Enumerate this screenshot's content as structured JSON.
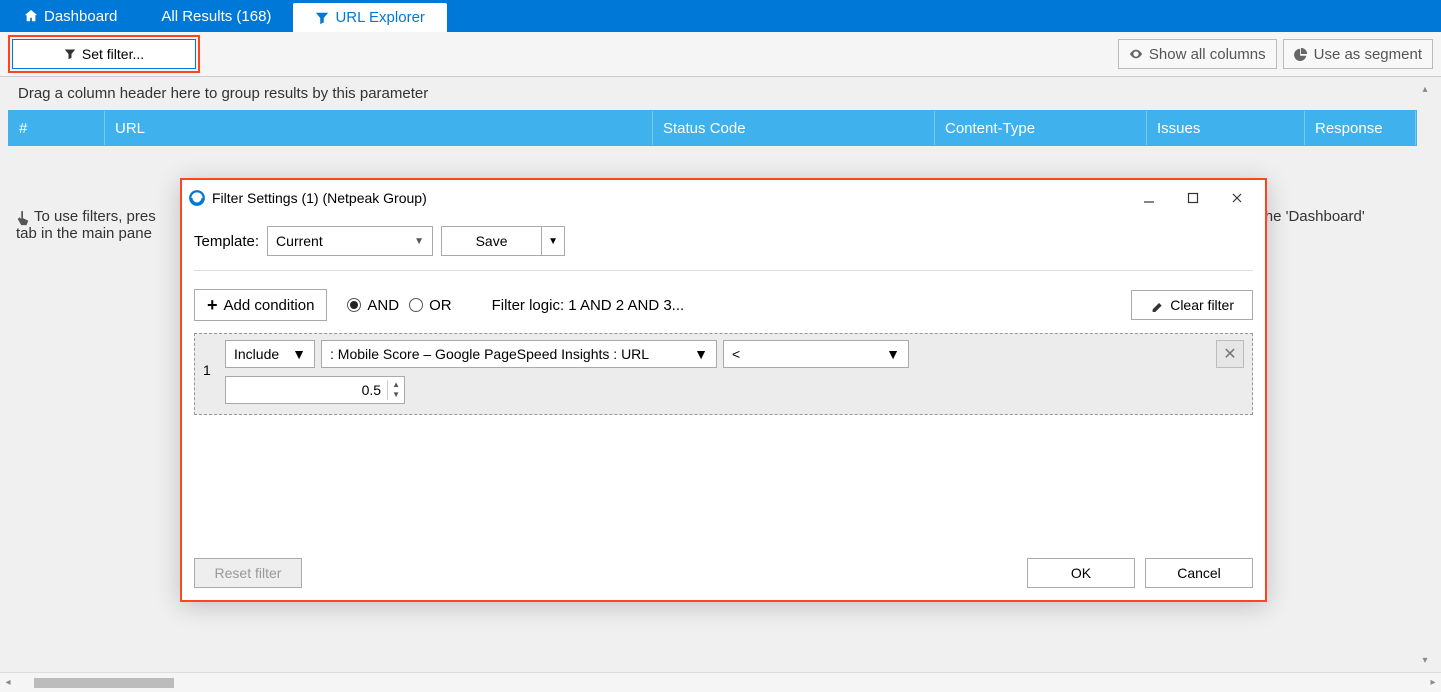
{
  "tabs": {
    "dashboard": "Dashboard",
    "all_results": "All Results (168)",
    "url_explorer": "URL Explorer"
  },
  "toolbar": {
    "set_filter": "Set filter...",
    "show_all": "Show all columns",
    "use_segment": "Use as segment"
  },
  "grid": {
    "group_hint": "Drag a column header here to group results by this parameter",
    "cols": {
      "num": "#",
      "url": "URL",
      "status": "Status Code",
      "ctype": "Content-Type",
      "issues": "Issues",
      "resp": "Response"
    }
  },
  "hint_left": "To use filters, pres",
  "hint_right": "s on the 'Dashboard'",
  "hint_line2": "tab in the main pane",
  "dialog": {
    "title": "Filter Settings (1) (Netpeak Group)",
    "template_label": "Template:",
    "template_value": "Current",
    "save": "Save",
    "add_condition": "Add condition",
    "logic_and": "AND",
    "logic_or": "OR",
    "filter_logic": "Filter logic: 1 AND 2 AND 3...",
    "clear_filter": "Clear filter",
    "row": {
      "idx": "1",
      "include": "Include",
      "field": ": Mobile Score  –  Google PageSpeed Insights  :  URL",
      "op": "<",
      "value": "0.5"
    },
    "reset": "Reset filter",
    "ok": "OK",
    "cancel": "Cancel"
  }
}
